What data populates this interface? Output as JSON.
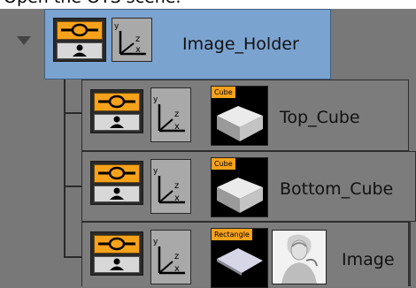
{
  "caption": {
    "text": "Open the OTS scene."
  },
  "colors": {
    "selected_row": "#7ba3cf",
    "row": "#7c7c7c",
    "visibility_orange": "#f7a21b",
    "background": "#787878"
  },
  "tree": {
    "root": {
      "name": "Image_Holder",
      "icons": [
        "eye-icon",
        "person-icon",
        "axis-icon"
      ]
    },
    "children": [
      {
        "name": "Top_Cube",
        "geometry_tag": "Cube",
        "thumbnail": "cube-icon"
      },
      {
        "name": "Bottom_Cube",
        "geometry_tag": "Cube",
        "thumbnail": "cube-icon"
      },
      {
        "name": "Image",
        "geometry_tag": "Rectangle",
        "thumbnail": "rectangle-icon",
        "image": "portrait-thumbnail"
      }
    ]
  }
}
